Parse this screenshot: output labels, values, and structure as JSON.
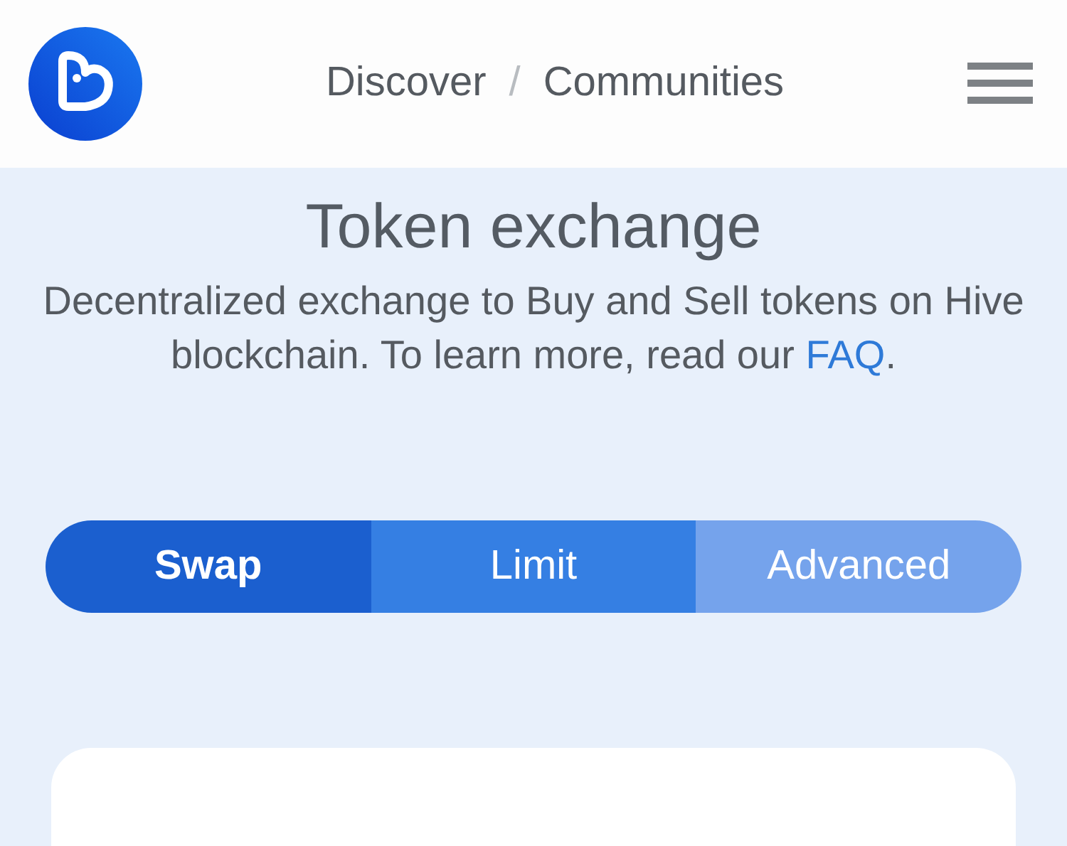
{
  "header": {
    "breadcrumb": [
      {
        "label": "Discover"
      },
      {
        "label": "/"
      },
      {
        "label": "Communities"
      }
    ]
  },
  "title": "Token exchange",
  "description": {
    "text": "Decentralized exchange to Buy and Sell tokens on Hive blockchain. To learn more, read our",
    "link": "FAQ",
    "end": "."
  },
  "tabs": [
    {
      "label": "Swap",
      "selected": true,
      "color": "#1b5fcf"
    },
    {
      "label": "Limit",
      "selected": false,
      "color": "#357fe3"
    },
    {
      "label": "Advanced",
      "selected": false,
      "color": "#75a3ec"
    }
  ]
}
